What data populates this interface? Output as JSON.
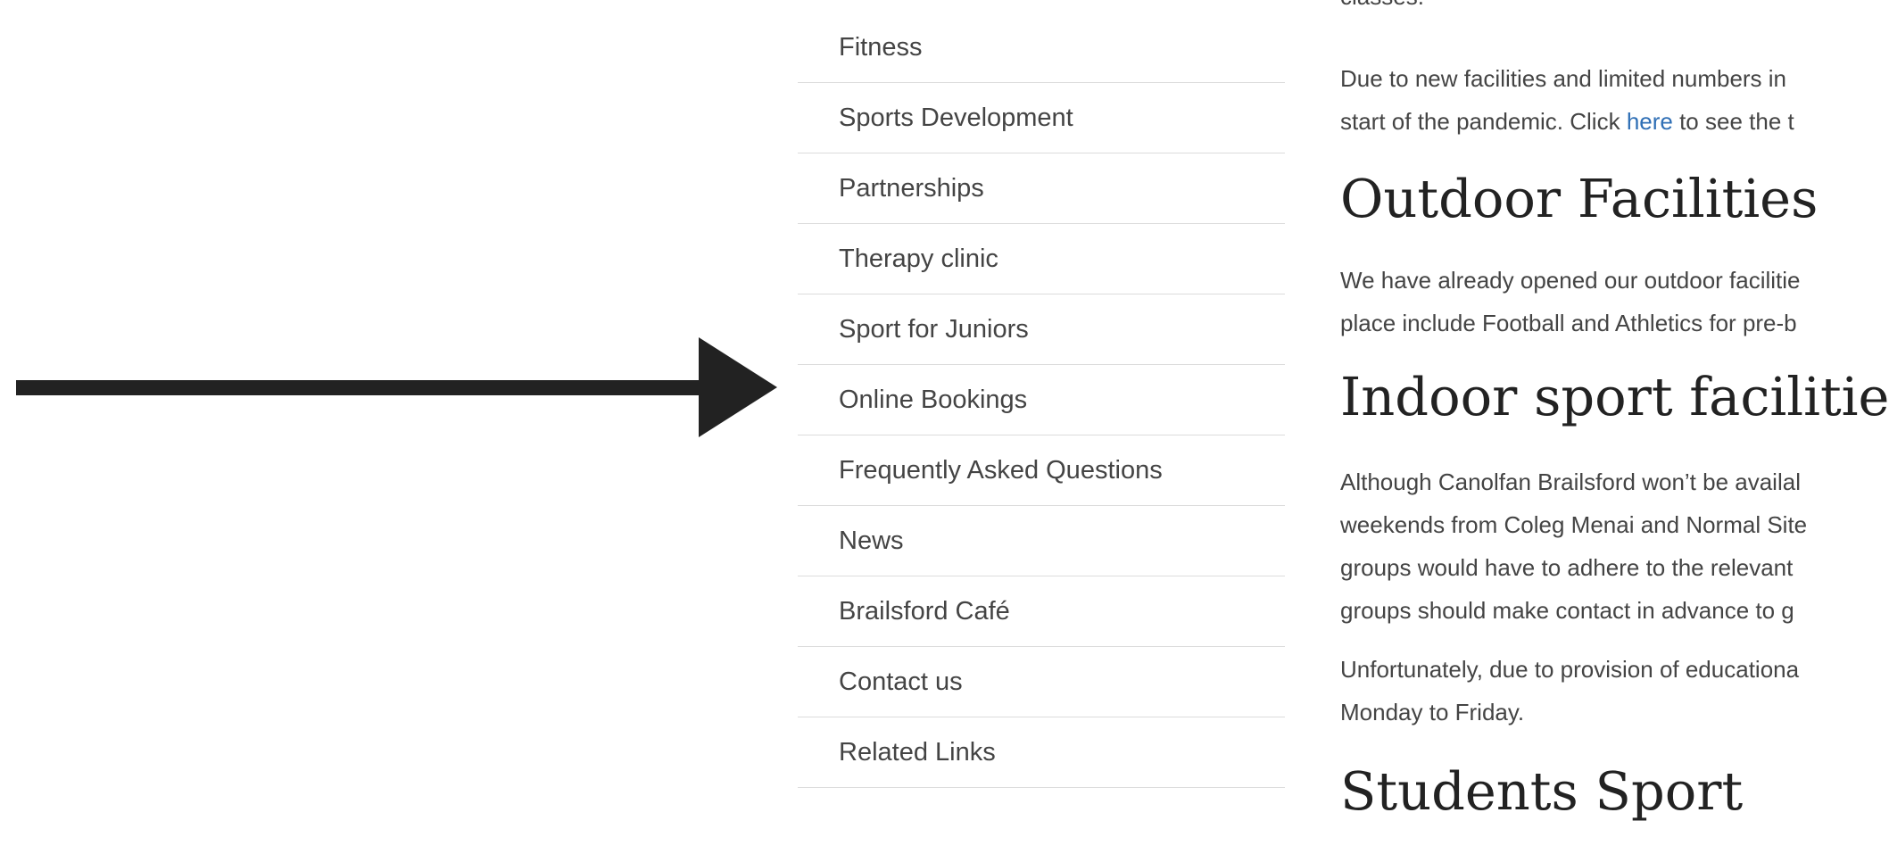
{
  "sidebar": {
    "items": [
      "Fitness",
      "Sports Development",
      "Partnerships",
      "Therapy clinic",
      "Sport for Juniors",
      "Online Bookings",
      "Frequently Asked Questions",
      "News",
      "Brailsford Café",
      "Contact us",
      "Related Links"
    ]
  },
  "content": {
    "cut_text": "classes.",
    "p1_line1": "Due to new facilities and limited numbers in",
    "p1_line2_pre": "start of the pandemic. Click ",
    "p1_link": "here",
    "p1_line2_post": " to see the t",
    "h_outdoor": "Outdoor Facilities",
    "p2_line1": "We have already opened our outdoor facilitie",
    "p2_line2": "place include Football and Athletics for pre-b",
    "h_indoor": "Indoor sport facilitie",
    "p3_line1": "Although Canolfan Brailsford won’t be availal",
    "p3_line2": "weekends from Coleg Menai and Normal Site",
    "p3_line3": "groups would have to adhere to the relevant",
    "p3_line4": "groups should make contact in advance to g",
    "p4_line1": "Unfortunately, due to provision of educationa",
    "p4_line2": "Monday to Friday.",
    "h_students": "Students Sport"
  },
  "colors": {
    "arrow": "#222222",
    "link": "#2f6fb5",
    "divider": "#dcdcdc"
  }
}
